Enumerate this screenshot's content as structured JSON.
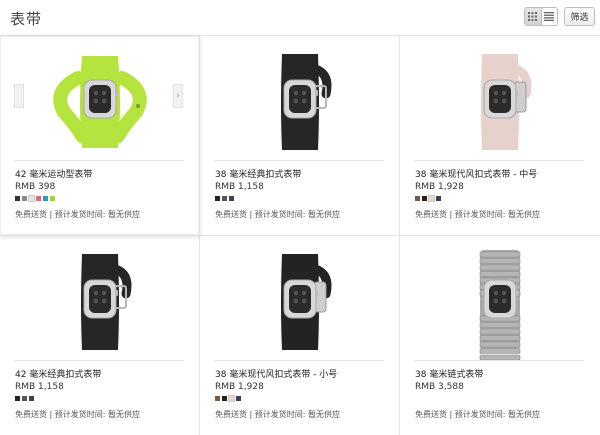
{
  "header": {
    "title": "表带",
    "filter_label": "筛选",
    "view_grid_icon": "grid-view-icon",
    "view_list_icon": "list-view-icon"
  },
  "products": [
    {
      "name": "42 毫米运动型表带",
      "price": "RMB 398",
      "swatches": [
        "#333333",
        "#8a8a8a",
        "#e4e4e4",
        "#e06a7a",
        "#3e8fd0",
        "#a6d23a"
      ],
      "shipping": "免费送货 | 预计发货时间: 暂无供应",
      "band_color": "#b6e43e",
      "band_style": "sport"
    },
    {
      "name": "38 毫米经典扣式表带",
      "price": "RMB 1,158",
      "swatches": [
        "#222222",
        "#555555",
        "#3f4150"
      ],
      "shipping": "免费送货 | 预计发货时间: 暂无供应",
      "band_color": "#262626",
      "band_style": "classic"
    },
    {
      "name": "38 毫米现代风扣式表带 - 中号",
      "price": "RMB 1,928",
      "swatches": [
        "#7a5a3e",
        "#222222",
        "#e8d6cf",
        "#3b3f5c"
      ],
      "shipping": "免费送货 | 预计发货时间: 暂无供应",
      "band_color": "#e6d2cb",
      "band_style": "modern"
    },
    {
      "name": "42 毫米经典扣式表带",
      "price": "RMB 1,158",
      "swatches": [
        "#222222",
        "#555555",
        "#3f4150"
      ],
      "shipping": "免费送货 | 预计发货时间: 暂无供应",
      "band_color": "#262626",
      "band_style": "classic"
    },
    {
      "name": "38 毫米现代风扣式表带 - 小号",
      "price": "RMB 1,928",
      "swatches": [
        "#7a5a3e",
        "#222222",
        "#e8d6cf",
        "#3b3f5c"
      ],
      "shipping": "免费送货 | 预计发货时间: 暂无供应",
      "band_color": "#232323",
      "band_style": "modern"
    },
    {
      "name": "38 毫米链式表带",
      "price": "RMB 3,588",
      "swatches": [],
      "shipping": "免费送货 | 预计发货时间: 暂无供应",
      "band_color": "#9a9a9a",
      "band_style": "link"
    }
  ],
  "carousel": {
    "prev_icon": "chevron-left-icon",
    "next_icon": "chevron-right-icon",
    "next_glyph": "›"
  }
}
